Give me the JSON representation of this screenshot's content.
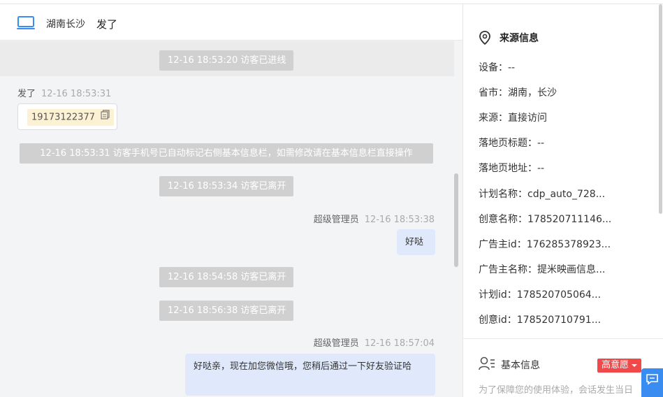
{
  "header": {
    "icon": "laptop-icon",
    "location": "湖南长沙",
    "visitor_name": "发了"
  },
  "messages": {
    "sys1": "12-16 18:53:20 访客已进线",
    "visitor_sender": "发了",
    "visitor_time": "12-16 18:53:31",
    "phone": "19173122377",
    "sys2": "12-16 18:53:31 访客手机号已自动标记右侧基本信息栏，如需修改请在基本信息栏直接操作",
    "sys3": "12-16 18:53:34 访客已离开",
    "agent_sender_1": "超级管理员",
    "agent_time_1": "12-16 18:53:38",
    "agent_msg_1": "好哒",
    "sys4": "12-16 18:54:58 访客已离开",
    "sys5": "12-16 18:56:38 访客已离开",
    "agent_sender_2": "超级管理员",
    "agent_time_2": "12-16 18:57:04",
    "agent_msg_2": "好哒亲，现在加您微信哦，您稍后通过一下好友验证哈"
  },
  "source_info": {
    "title": "来源信息",
    "rows": [
      "设备：--",
      "省市：湖南，长沙",
      "来源：直接访问",
      "落地页标题：--",
      "落地页地址：--",
      "计划名称：cdp_auto_728...",
      "创意名称：178520711146...",
      "广告主id：176285378923...",
      "广告主名称：提米映画信息...",
      "计划id：178520705064...",
      "创意id：178520710791..."
    ]
  },
  "basic_info": {
    "title": "基本信息",
    "intent_badge": "高意愿",
    "note": "为了保障您的使用体验，会话发生当日"
  },
  "colors": {
    "badge": "#f04949",
    "agent_bubble": "#dfe9fb",
    "accent": "#3b8cf1"
  }
}
